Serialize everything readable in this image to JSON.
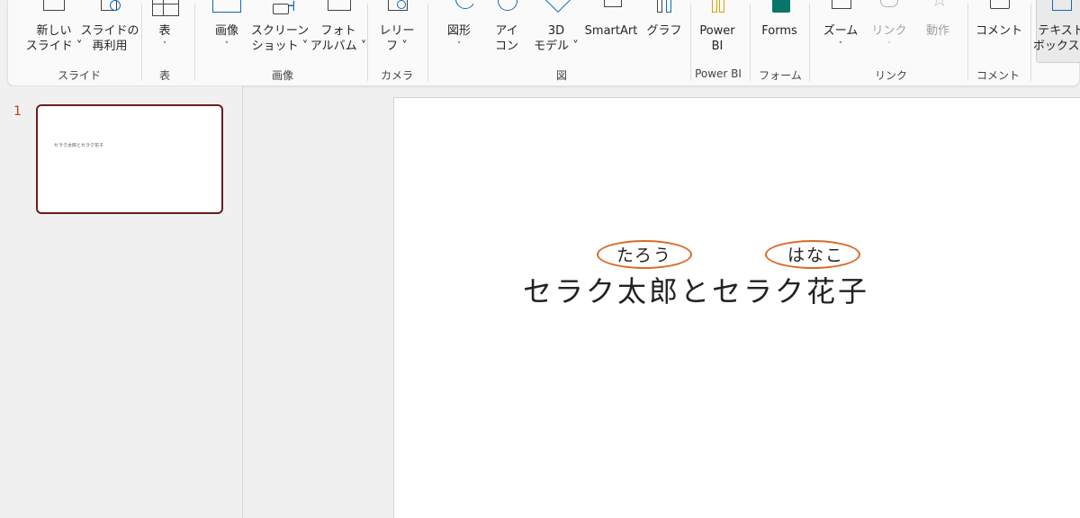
{
  "ribbon": {
    "buttons": [
      {
        "name": "new-slide-button",
        "line1": "新しい",
        "line2": "スライド ˅",
        "icon": "new-slide-icon"
      },
      {
        "name": "reuse-slides-button",
        "line1": "スライドの",
        "line2": "再利用",
        "icon": "reuse-slides-icon"
      },
      {
        "name": "table-button",
        "line1": "表",
        "line2": "˅",
        "icon": "table-icon"
      },
      {
        "name": "pictures-button",
        "line1": "画像",
        "line2": "˅",
        "icon": "picture-icon"
      },
      {
        "name": "screenshot-button",
        "line1": "スクリーン",
        "line2": "ショット ˅",
        "icon": "screenshot-icon"
      },
      {
        "name": "photo-album-button",
        "line1": "フォト",
        "line2": "アルバム ˅",
        "icon": "photo-album-icon"
      },
      {
        "name": "cameo-button",
        "line1": "レリー",
        "line2": "フ ˅",
        "icon": "cameo-icon"
      },
      {
        "name": "shapes-button",
        "line1": "図形",
        "line2": "˅",
        "icon": "shapes-icon"
      },
      {
        "name": "icons-button",
        "line1": "アイ",
        "line2": "コン",
        "icon": "icons-icon"
      },
      {
        "name": "3d-models-button",
        "line1": "3D",
        "line2": "モデル ˅",
        "icon": "3d-model-icon"
      },
      {
        "name": "smartart-button",
        "line1": "SmartArt",
        "line2": "",
        "icon": "smartart-icon"
      },
      {
        "name": "chart-button",
        "line1": "グラフ",
        "line2": "",
        "icon": "chart-icon"
      },
      {
        "name": "power-bi-button",
        "line1": "Power",
        "line2": "BI",
        "icon": "power-bi-icon"
      },
      {
        "name": "forms-button",
        "line1": "Forms",
        "line2": "",
        "icon": "forms-icon"
      },
      {
        "name": "zoom-button",
        "line1": "ズーム",
        "line2": "˅",
        "icon": "zoom-icon"
      },
      {
        "name": "link-button",
        "line1": "リンク",
        "line2": "˅",
        "icon": "link-icon"
      },
      {
        "name": "action-button",
        "line1": "動作",
        "line2": "",
        "icon": "action-icon"
      },
      {
        "name": "comment-button",
        "line1": "コメント",
        "line2": "",
        "icon": "comment-icon"
      },
      {
        "name": "textbox-button",
        "line1": "テキスト",
        "line2": "ボックス ˅",
        "icon": "textbox-icon"
      }
    ],
    "groups": {
      "slides": "スライド",
      "tables": "表",
      "images": "画像",
      "camera": "カメラ",
      "illustrations": "図",
      "powerbi": "Power BI",
      "forms": "フォーム",
      "links": "リンク",
      "comments": "コメント"
    }
  },
  "slide_panel": {
    "slide_number": "1",
    "thumbnail_text": "セラク太郎とセラク花子"
  },
  "slide": {
    "main_text": "セラク太郎とセラク花子",
    "ruby_1": "たろう",
    "ruby_2": "はなこ",
    "annotation_color": "#d96a2a"
  },
  "colors": {
    "accent": "#c43e1c",
    "thumbnail_border": "#6b1d1d"
  }
}
